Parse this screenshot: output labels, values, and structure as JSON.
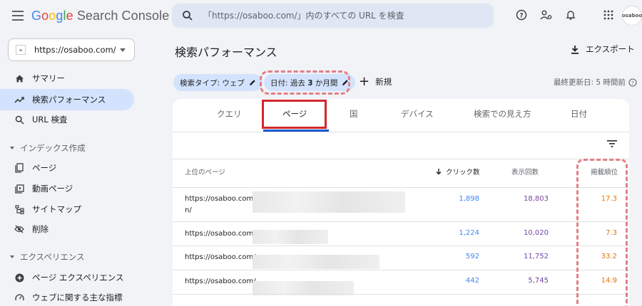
{
  "header": {
    "logo_google": [
      "G",
      "o",
      "o",
      "g",
      "l",
      "e"
    ],
    "logo_product": "Search Console",
    "search_placeholder": "「https://osaboo.com/」内のすべての URL を検査",
    "icons": [
      "help-icon",
      "manage-accounts-icon",
      "notifications-icon",
      "apps-icon"
    ],
    "avatar_text": "osaboo"
  },
  "sidebar": {
    "property": "https://osaboo.com/",
    "items": [
      {
        "label": "サマリー",
        "icon": "home-icon"
      },
      {
        "label": "検索パフォーマンス",
        "icon": "trending-up-icon",
        "active": true
      },
      {
        "label": "URL 検査",
        "icon": "search-icon"
      }
    ],
    "sections": [
      {
        "title": "インデックス作成",
        "items": [
          {
            "label": "ページ",
            "icon": "pages-icon"
          },
          {
            "label": "動画ページ",
            "icon": "video-page-icon"
          },
          {
            "label": "サイトマップ",
            "icon": "sitemap-icon"
          },
          {
            "label": "削除",
            "icon": "visibility-off-icon"
          }
        ]
      },
      {
        "title": "エクスペリエンス",
        "items": [
          {
            "label": "ページ エクスペリエンス",
            "icon": "add-circle-icon"
          },
          {
            "label": "ウェブに関する主な指標",
            "icon": "speed-icon"
          }
        ]
      }
    ]
  },
  "main": {
    "title": "検索パフォーマンス",
    "export_label": "エクスポート",
    "filters": {
      "search_type": "検索タイプ: ウェブ",
      "date_prefix": "日付: 過去 ",
      "date_number": "3",
      "date_suffix": " か月間",
      "new_label": "新規"
    },
    "last_updated": "最終更新日: 5 時間前",
    "tabs": [
      "クエリ",
      "ページ",
      "国",
      "デバイス",
      "検索での見え方",
      "日付"
    ],
    "active_tab": "ページ",
    "table": {
      "headers": {
        "page": "上位のページ",
        "clicks": "クリック数",
        "impressions": "表示回数",
        "position": "掲載順位"
      },
      "rows": [
        {
          "url": "https://osaboo.com/",
          "url_cont": "n/",
          "clicks": "1,898",
          "impressions": "18,803",
          "position": "17.3"
        },
        {
          "url": "https://osaboo.com/",
          "url_cont": "",
          "clicks": "1,224",
          "impressions": "10,020",
          "position": "7.3"
        },
        {
          "url": "https://osaboo.com/",
          "url_cont": "",
          "clicks": "592",
          "impressions": "11,752",
          "position": "33.2"
        },
        {
          "url": "https://osaboo.com/",
          "url_cont": "",
          "clicks": "442",
          "impressions": "5,745",
          "position": "14.9"
        }
      ]
    }
  },
  "colors": {
    "accent": "#0b57d0",
    "active_bg": "#d3e3fd",
    "clicks": "#4285f4",
    "impressions": "#7b43a1",
    "position": "#e37400",
    "highlight_red": "#d3262b",
    "highlight_dashed": "#e27f88"
  }
}
